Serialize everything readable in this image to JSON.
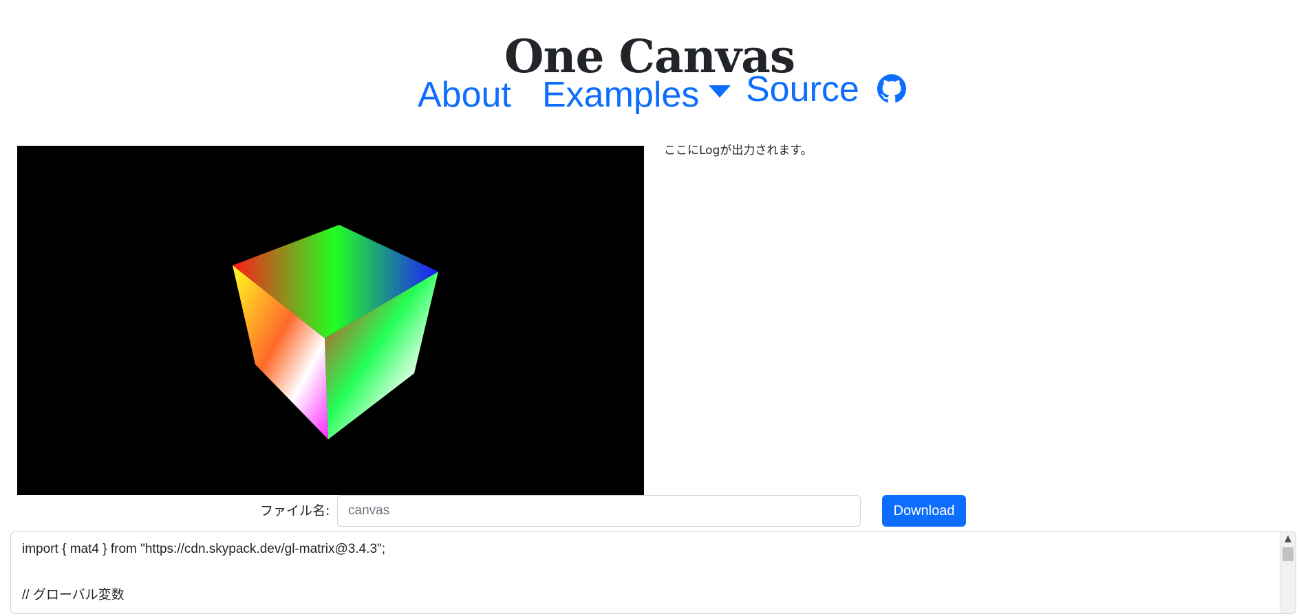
{
  "header": {
    "title": "One Canvas"
  },
  "nav": {
    "about": "About",
    "examples": "Examples",
    "source": "Source"
  },
  "log": {
    "placeholder": "ここにLogが出力されます。"
  },
  "file": {
    "label": "ファイル名:",
    "placeholder": "canvas",
    "download_label": "Download"
  },
  "editor": {
    "lines": [
      "import { mat4 } from \"https://cdn.skypack.dev/gl-matrix@3.4.3\";",
      "// グローバル変数"
    ]
  },
  "colors": {
    "link": "#0d6efd",
    "button": "#0d6efd",
    "canvas_bg": "#000000"
  }
}
